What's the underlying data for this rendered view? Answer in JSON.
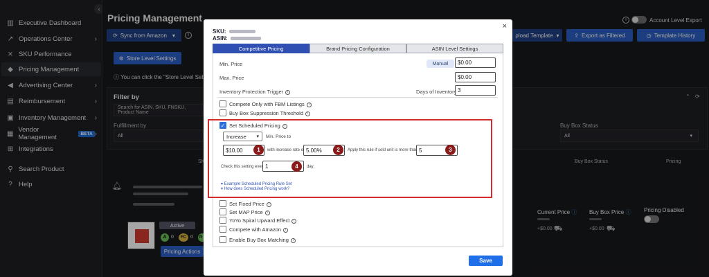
{
  "sidebar": {
    "items": [
      {
        "label": "Executive Dashboard",
        "icon": "bar-chart-icon",
        "chevron": false
      },
      {
        "label": "Operations Center",
        "icon": "trend-icon",
        "chevron": true
      },
      {
        "label": "SKU Performance",
        "icon": "sku-icon",
        "chevron": false
      },
      {
        "label": "Pricing Management",
        "icon": "tag-icon",
        "chevron": false
      },
      {
        "label": "Advertising Center",
        "icon": "megaphone-icon",
        "chevron": true
      },
      {
        "label": "Reimbursement",
        "icon": "reimbursement-icon",
        "chevron": true
      },
      {
        "label": "Inventory Management",
        "icon": "inventory-icon",
        "chevron": true
      },
      {
        "label": "Vendor Management",
        "icon": "vendor-icon",
        "chevron": true,
        "badge": "BETA"
      },
      {
        "label": "Integrations",
        "icon": "integrations-icon",
        "chevron": false
      },
      {
        "label": "Search Product",
        "icon": "search-icon",
        "chevron": false
      },
      {
        "label": "Help",
        "icon": "help-icon",
        "chevron": false
      }
    ]
  },
  "header": {
    "title": "Pricing Management",
    "sync_button": "Sync from Amazon",
    "account_level_export": "Account Level Export",
    "upload_template": "pload Template",
    "export_filtered": "Export as Filtered",
    "template_history": "Template History",
    "store_level_settings": "Store Level Settings",
    "store_notice": "You can click the \"Store Level Setting"
  },
  "filter": {
    "title": "Filter by",
    "search_placeholder": "Search for ASIN, SKU, FNSKU, Product Name",
    "fulfillment_label": "Fulfillment by",
    "fulfillment_value": "All",
    "buybox_label": "Buy Box Status",
    "buybox_value": "All"
  },
  "table": {
    "col_sk": "SK",
    "col_buybox_status": "Buy Box Status",
    "col_pricing": "Pricing",
    "current_price": "Current Price",
    "buy_box_price": "Buy Box Price",
    "pricing_disabled": "Pricing Disabled",
    "current_price_val": "+$0.00",
    "buy_box_price_val": "+$0.00",
    "active_label": "Active",
    "pricing_actions": "Pricing Actions",
    "circles": [
      "A",
      "0",
      "FC",
      "0",
      "R"
    ]
  },
  "modal": {
    "sku_label": "SKU:",
    "asin_label": "ASIN:",
    "tabs": [
      "Competitive Pricing",
      "Brand Pricing Configuration",
      "ASIN Level Settings"
    ],
    "min_price_label": "Min. Price",
    "manual_label": "Manual",
    "min_price_value": "$0.00",
    "max_price_label": "Max. Price",
    "max_price_value": "$0.00",
    "inventory_trigger_label": "Inventory Protection Trigger",
    "days_inventory_label": "Days of Inventory:",
    "days_inventory_value": "3",
    "compete_fbm": "Compete Only with FBM Listings",
    "buybox_suppression": "Buy Box Suppression Threshold",
    "scheduled": {
      "label": "Set Scheduled Pricing",
      "direction": "Increase",
      "min_price_to_label": "Min. Price to",
      "amount": "$10.00",
      "rate_label": "with increase rate of",
      "rate": "5.00%",
      "rule_label": "Apply this rule if sold unit is more than",
      "units": "5",
      "check_label": "Check this setting every",
      "check_value": "1",
      "day_label": "day.",
      "link1": "Example Scheduled Pricing Rule Set",
      "link2": "How does Scheduled Pricing work?",
      "badges": [
        "1",
        "2",
        "3",
        "4"
      ]
    },
    "set_fixed_price": "Set Fixed Price",
    "set_map_price": "Set MAP Price",
    "yoyo": "YoYo Spiral Upward Effect",
    "compete_amazon": "Compete with Amazon",
    "enable_buybox": "Enable Buy Box Matching",
    "save": "Save",
    "close": "×"
  }
}
